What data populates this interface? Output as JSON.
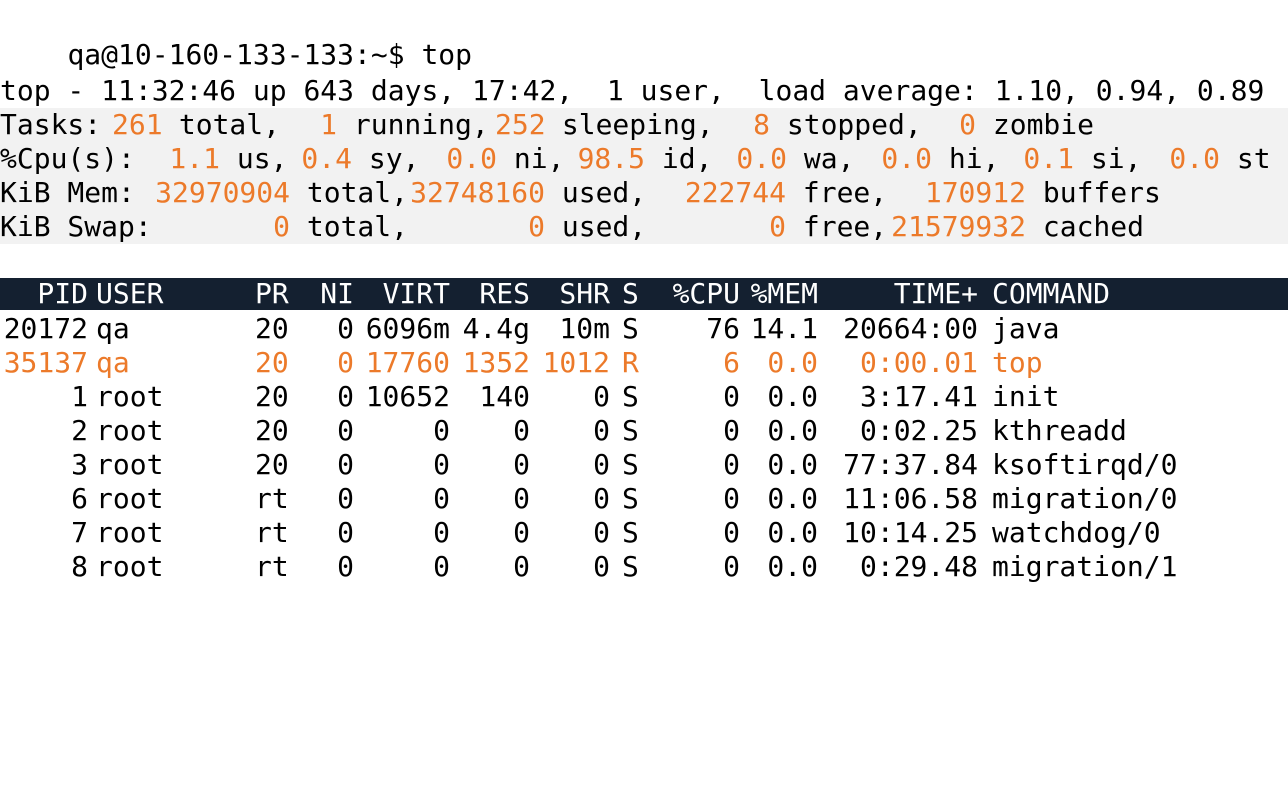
{
  "prompt": {
    "host_prompt": "qa@10-160-133-133:~$",
    "command": "top"
  },
  "summary": {
    "line1": {
      "prefix": "top - ",
      "time": "11:32:46",
      "uptime_label": " up 643 days, 17:42,",
      "users": "  1 user,",
      "load_label": "  load average:",
      "load_values": " 1.10, 0.94, 0.89"
    },
    "tasks": {
      "label": "Tasks:",
      "total": "261",
      "total_label": " total,",
      "running": "1",
      "running_label": " running,",
      "sleeping": "252",
      "sleeping_label": " sleeping,",
      "stopped": "8",
      "stopped_label": " stopped,",
      "zombie": "0",
      "zombie_label": " zombie"
    },
    "cpu": {
      "label": "%Cpu(s):",
      "us": "1.1",
      "us_label": " us,",
      "sy": "0.4",
      "sy_label": " sy,",
      "ni": "0.0",
      "ni_label": " ni,",
      "id": "98.5",
      "id_label": " id,",
      "wa": "0.0",
      "wa_label": " wa,",
      "hi": "0.0",
      "hi_label": " hi,",
      "si": "0.1",
      "si_label": " si,",
      "st": "0.0",
      "st_label": " st"
    },
    "mem": {
      "label": "KiB Mem:",
      "total": "32970904",
      "total_label": " total,",
      "used": "32748160",
      "used_label": " used,",
      "free": "222744",
      "free_label": " free,",
      "buffers": "170912",
      "buffers_label": " buffers"
    },
    "swap": {
      "label": "KiB Swap:",
      "total": "0",
      "total_label": " total,",
      "used": "0",
      "used_label": " used,",
      "free": "0",
      "free_label": " free,",
      "cached": "21579932",
      "cached_label": " cached"
    }
  },
  "table": {
    "columns": [
      "PID",
      "USER",
      "PR",
      "NI",
      "VIRT",
      "RES",
      "SHR",
      "S",
      "%CPU",
      "%MEM",
      "TIME+",
      "COMMAND"
    ],
    "rows": [
      {
        "pid": "20172",
        "user": "qa",
        "pr": "20",
        "ni": "0",
        "virt": "6096m",
        "res": "4.4g",
        "shr": "10m",
        "s": "S",
        "cpu": "76",
        "mem": "14.1",
        "time": "20664:00",
        "command": "java",
        "highlight": false
      },
      {
        "pid": "35137",
        "user": "qa",
        "pr": "20",
        "ni": "0",
        "virt": "17760",
        "res": "1352",
        "shr": "1012",
        "s": "R",
        "cpu": "6",
        "mem": "0.0",
        "time": "0:00.01",
        "command": "top",
        "highlight": true
      },
      {
        "pid": "1",
        "user": "root",
        "pr": "20",
        "ni": "0",
        "virt": "10652",
        "res": "140",
        "shr": "0",
        "s": "S",
        "cpu": "0",
        "mem": "0.0",
        "time": "3:17.41",
        "command": "init",
        "highlight": false
      },
      {
        "pid": "2",
        "user": "root",
        "pr": "20",
        "ni": "0",
        "virt": "0",
        "res": "0",
        "shr": "0",
        "s": "S",
        "cpu": "0",
        "mem": "0.0",
        "time": "0:02.25",
        "command": "kthreadd",
        "highlight": false
      },
      {
        "pid": "3",
        "user": "root",
        "pr": "20",
        "ni": "0",
        "virt": "0",
        "res": "0",
        "shr": "0",
        "s": "S",
        "cpu": "0",
        "mem": "0.0",
        "time": "77:37.84",
        "command": "ksoftirqd/0",
        "highlight": false
      },
      {
        "pid": "6",
        "user": "root",
        "pr": "rt",
        "ni": "0",
        "virt": "0",
        "res": "0",
        "shr": "0",
        "s": "S",
        "cpu": "0",
        "mem": "0.0",
        "time": "11:06.58",
        "command": "migration/0",
        "highlight": false
      },
      {
        "pid": "7",
        "user": "root",
        "pr": "rt",
        "ni": "0",
        "virt": "0",
        "res": "0",
        "shr": "0",
        "s": "S",
        "cpu": "0",
        "mem": "0.0",
        "time": "10:14.25",
        "command": "watchdog/0",
        "highlight": false
      },
      {
        "pid": "8",
        "user": "root",
        "pr": "rt",
        "ni": "0",
        "virt": "0",
        "res": "0",
        "shr": "0",
        "s": "S",
        "cpu": "0",
        "mem": "0.0",
        "time": "0:29.48",
        "command": "migration/1",
        "highlight": false
      }
    ]
  },
  "colors": {
    "highlight": "#ec7a2a",
    "header_bg": "#142030",
    "header_fg": "#ffffff",
    "text": "#000000"
  }
}
